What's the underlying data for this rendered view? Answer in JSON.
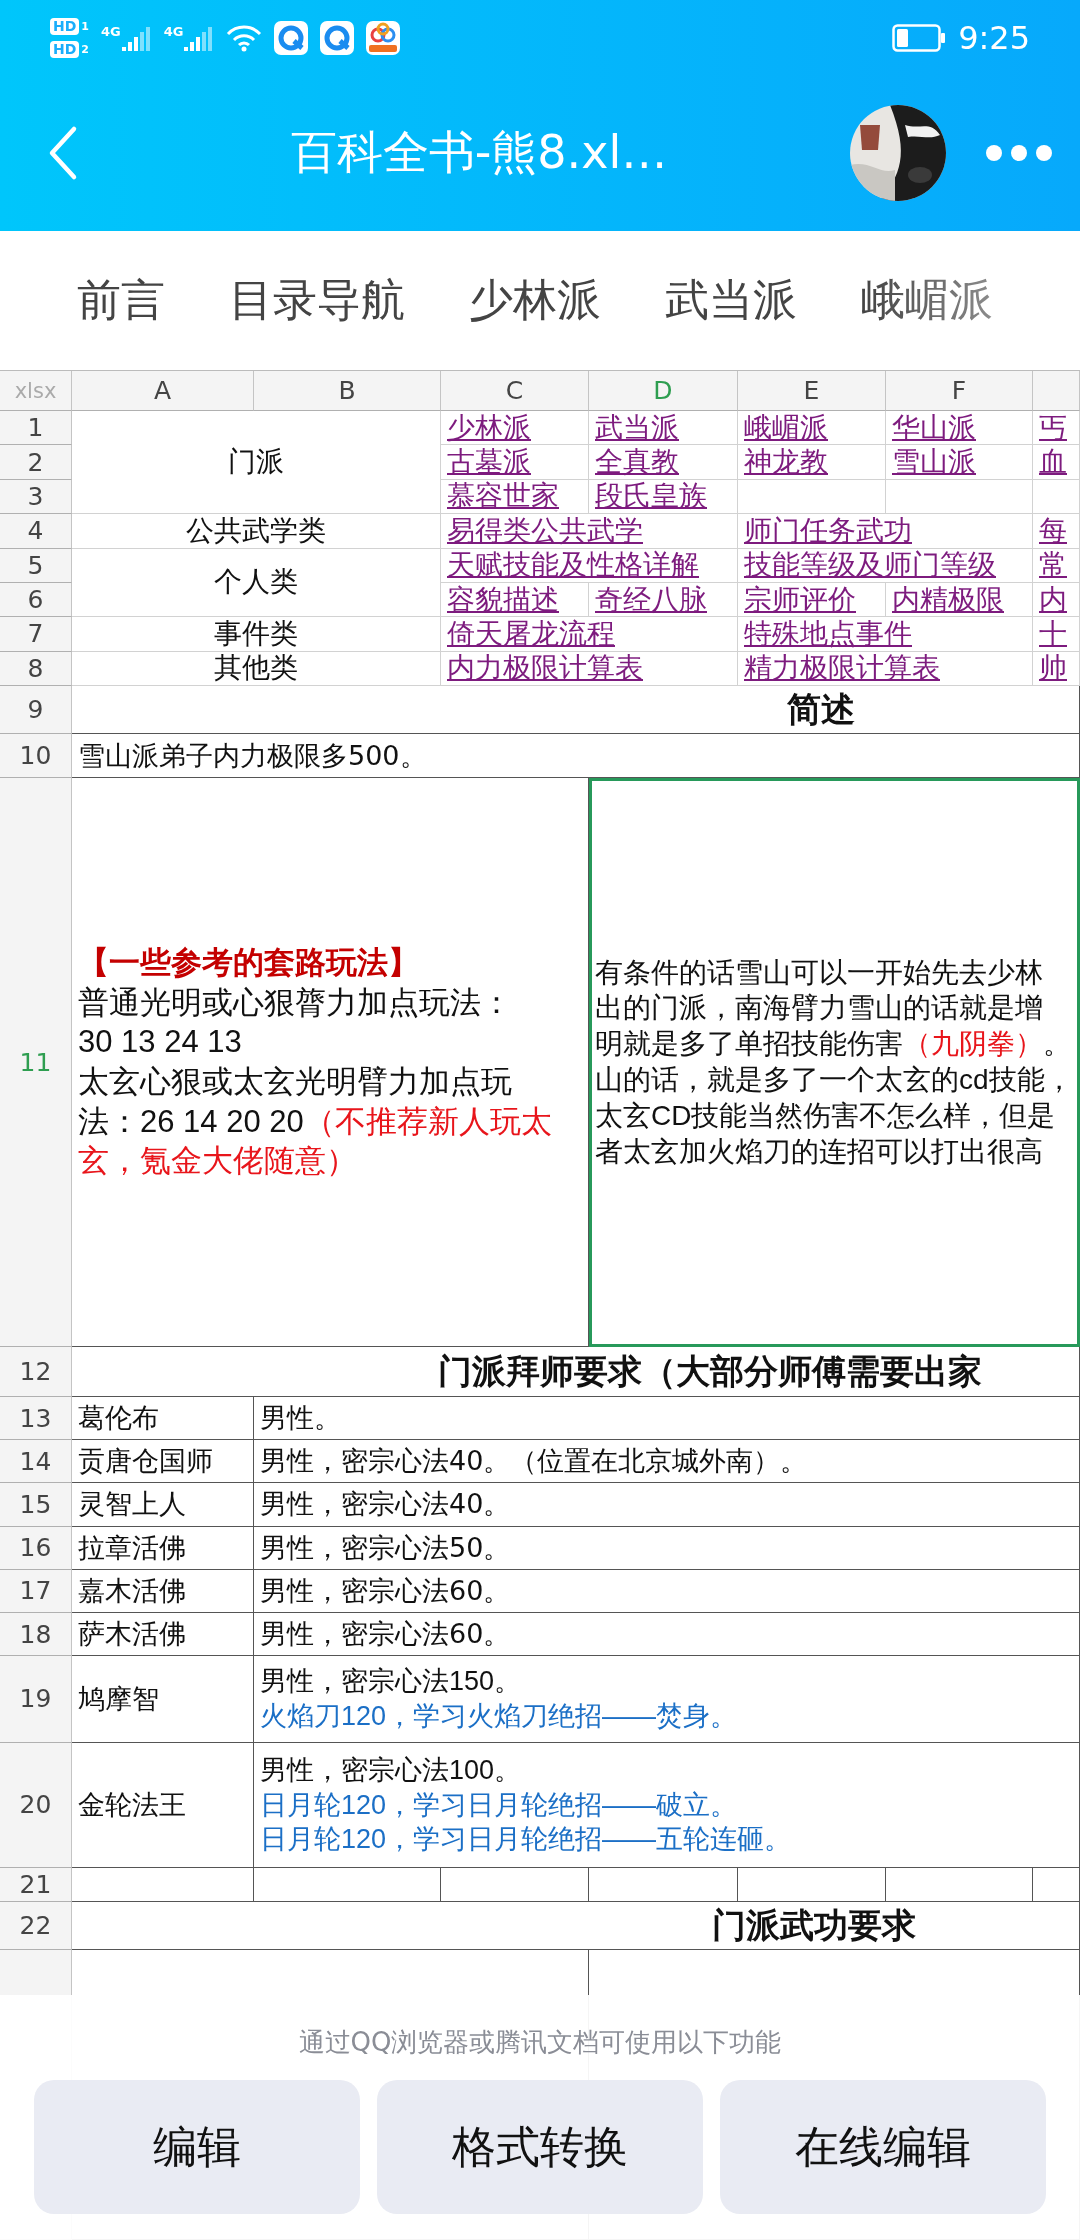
{
  "status_bar": {
    "sims": [
      {
        "badge": "HD",
        "slot": "1",
        "network": "4G"
      },
      {
        "badge": "HD",
        "slot": "2",
        "network": "4G"
      }
    ],
    "time": "9:25"
  },
  "header": {
    "title": "百科全书-熊8.xl…"
  },
  "sheet_tabs": [
    {
      "label": "前言"
    },
    {
      "label": "目录导航"
    },
    {
      "label": "少林派"
    },
    {
      "label": "武当派"
    },
    {
      "label": "峨嵋派"
    }
  ],
  "sheet": {
    "corner": "xlsx",
    "columns": [
      {
        "label": "A",
        "selected": false
      },
      {
        "label": "B",
        "selected": false
      },
      {
        "label": "C",
        "selected": false
      },
      {
        "label": "D",
        "selected": true
      },
      {
        "label": "E",
        "selected": false
      },
      {
        "label": "F",
        "selected": false
      }
    ],
    "rows": [
      {
        "label": "1",
        "selected": false
      },
      {
        "label": "2",
        "selected": false
      },
      {
        "label": "3",
        "selected": false
      },
      {
        "label": "4",
        "selected": false
      },
      {
        "label": "5",
        "selected": false
      },
      {
        "label": "6",
        "selected": false
      },
      {
        "label": "7",
        "selected": false
      },
      {
        "label": "8",
        "selected": false
      },
      {
        "label": "9",
        "selected": false
      },
      {
        "label": "10",
        "selected": false
      },
      {
        "label": "11",
        "selected": true
      },
      {
        "label": "12",
        "selected": false
      },
      {
        "label": "13",
        "selected": false
      },
      {
        "label": "14",
        "selected": false
      },
      {
        "label": "15",
        "selected": false
      },
      {
        "label": "16",
        "selected": false
      },
      {
        "label": "17",
        "selected": false
      },
      {
        "label": "18",
        "selected": false
      },
      {
        "label": "19",
        "selected": false
      },
      {
        "label": "20",
        "selected": false
      },
      {
        "label": "21",
        "selected": false
      },
      {
        "label": "22",
        "selected": false
      }
    ],
    "cells": [
      {
        "kind": "label",
        "text": "门派"
      },
      {
        "kind": "link",
        "text": "少林派"
      },
      {
        "kind": "link",
        "text": "武当派"
      },
      {
        "kind": "link",
        "text": "峨嵋派"
      },
      {
        "kind": "link",
        "text": "华山派"
      },
      {
        "kind": "link",
        "text": "丐"
      },
      {
        "kind": "link",
        "text": "古墓派"
      },
      {
        "kind": "link",
        "text": "全真教"
      },
      {
        "kind": "link",
        "text": "神龙教"
      },
      {
        "kind": "link",
        "text": "雪山派"
      },
      {
        "kind": "link",
        "text": "血"
      },
      {
        "kind": "link",
        "text": "慕容世家"
      },
      {
        "kind": "link",
        "text": "段氏皇族"
      },
      {
        "kind": "label",
        "text": "公共武学类"
      },
      {
        "kind": "link",
        "text": "易得类公共武学"
      },
      {
        "kind": "link",
        "text": "师门任务武功"
      },
      {
        "kind": "link",
        "text": "每"
      },
      {
        "kind": "label",
        "text": "个人类"
      },
      {
        "kind": "link",
        "text": "天赋技能及性格详解"
      },
      {
        "kind": "link",
        "text": "技能等级及师门等级"
      },
      {
        "kind": "link",
        "text": "常"
      },
      {
        "kind": "link",
        "text": "容貌描述"
      },
      {
        "kind": "link",
        "text": "奇经八脉"
      },
      {
        "kind": "link",
        "text": "宗师评价"
      },
      {
        "kind": "link",
        "text": "内精极限"
      },
      {
        "kind": "link",
        "text": "内"
      },
      {
        "kind": "label",
        "text": "事件类"
      },
      {
        "kind": "link",
        "text": "倚天屠龙流程"
      },
      {
        "kind": "link",
        "text": "特殊地点事件"
      },
      {
        "kind": "link",
        "text": "十"
      },
      {
        "kind": "label",
        "text": "其他类"
      },
      {
        "kind": "link",
        "text": "内力极限计算表"
      },
      {
        "kind": "link",
        "text": "精力极限计算表"
      },
      {
        "kind": "link",
        "text": "帅"
      },
      {
        "kind": "heading",
        "text": "简述"
      },
      {
        "kind": "text",
        "text": "雪山派弟子内力极限多500。"
      },
      {
        "kind": "lines",
        "lines": [
          [
            {
              "kind": "title",
              "text": "【一些参考的套路玩法】"
            }
          ],
          [
            {
              "kind": "plain",
              "text": "普通光明或心狠膂力加点玩法："
            }
          ],
          [
            {
              "kind": "plain",
              "text": "30 13 24 13"
            }
          ],
          [
            {
              "kind": "plain",
              "text": "太玄心狠或太玄光明臂力加点玩"
            }
          ],
          [
            {
              "kind": "plain",
              "text": "法：26 14 20 20"
            },
            {
              "kind": "warning",
              "text": "（不推荐新人玩太"
            }
          ],
          [
            {
              "kind": "warning",
              "text": "玄，氪金大佬随意）"
            }
          ]
        ]
      },
      {
        "kind": "lines",
        "lines": [
          [
            {
              "kind": "plain",
              "text": "有条件的话雪山可以一开始先去少林"
            }
          ],
          [
            {
              "kind": "plain",
              "text": "出的门派，南海臂力雪山的话就是增"
            }
          ],
          [
            {
              "kind": "plain",
              "text": "明就是多了单招技能伤害"
            },
            {
              "kind": "warning",
              "text": "（九阴拳）"
            },
            {
              "kind": "plain",
              "text": "。"
            }
          ],
          [
            {
              "kind": "plain",
              "text": "山的话，就是多了一个太玄的cd技能，"
            }
          ],
          [
            {
              "kind": "plain",
              "text": "太玄CD技能当然伤害不怎么样，但是"
            }
          ],
          [
            {
              "kind": "plain",
              "text": "者太玄加火焰刀的连招可以打出很高"
            }
          ]
        ]
      },
      {
        "kind": "heading",
        "text": "门派拜师要求（大部分师傅需要出家"
      },
      {
        "kind": "text",
        "text": "葛伦布"
      },
      {
        "kind": "text",
        "text": "男性。"
      },
      {
        "kind": "text",
        "text": "贡唐仓国师"
      },
      {
        "kind": "text",
        "text": "男性，密宗心法40。（位置在北京城外南）。"
      },
      {
        "kind": "text",
        "text": "灵智上人"
      },
      {
        "kind": "text",
        "text": "男性，密宗心法40。"
      },
      {
        "kind": "text",
        "text": "拉章活佛"
      },
      {
        "kind": "text",
        "text": "男性，密宗心法50。"
      },
      {
        "kind": "text",
        "text": "嘉木活佛"
      },
      {
        "kind": "text",
        "text": "男性，密宗心法60。"
      },
      {
        "kind": "text",
        "text": "萨木活佛"
      },
      {
        "kind": "text",
        "text": "男性，密宗心法60。"
      },
      {
        "kind": "text",
        "text": "鸠摩智"
      },
      {
        "kind": "lines",
        "lines": [
          [
            {
              "kind": "plain",
              "text": "男性，密宗心法150。"
            }
          ],
          [
            {
              "kind": "skill",
              "text": "火焰刀120，学习火焰刀绝招——焚身。"
            }
          ]
        ]
      },
      {
        "kind": "text",
        "text": "金轮法王"
      },
      {
        "kind": "lines",
        "lines": [
          [
            {
              "kind": "plain",
              "text": "男性，密宗心法100。"
            }
          ],
          [
            {
              "kind": "skill",
              "text": "日月轮120，学习日月轮绝招——破立。"
            }
          ],
          [
            {
              "kind": "skill",
              "text": "日月轮120，学习日月轮绝招——五轮连砸。"
            }
          ]
        ]
      },
      {
        "kind": "heading",
        "text": "门派武功要求"
      }
    ]
  },
  "bottom_bar": {
    "hint": "通过QQ浏览器或腾讯文档可使用以下功能",
    "buttons": [
      {
        "label": "编辑"
      },
      {
        "label": "格式转换"
      },
      {
        "label": "在线编辑"
      }
    ]
  }
}
